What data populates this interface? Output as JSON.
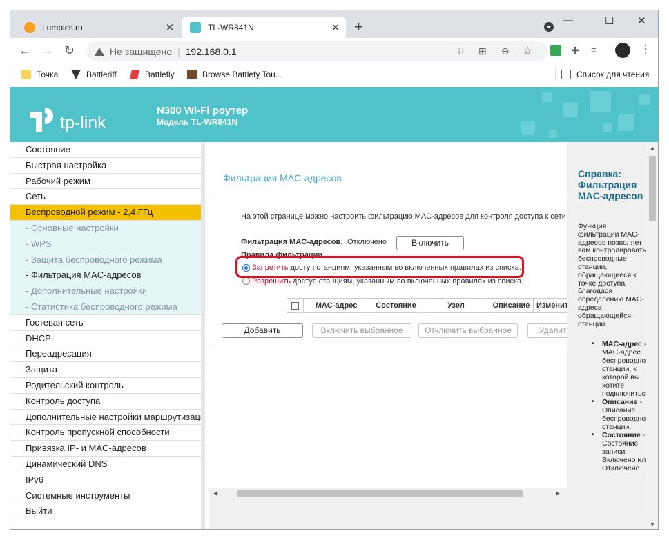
{
  "browser": {
    "tabs": [
      {
        "title": "Lumpics.ru",
        "icon": "orange-favicon",
        "close": "✕"
      },
      {
        "title": "TL-WR841N",
        "icon": "tplink-favicon",
        "close": "✕"
      }
    ],
    "new_tab": "+",
    "window_controls": {
      "minimize": "—",
      "maximize": "☐",
      "close": "✕"
    },
    "address": {
      "security_text": "Не защищено",
      "separator": "|",
      "url": "192.168.0.1"
    },
    "bookmarks": [
      {
        "label": "Точка",
        "icon": "folder-icon"
      },
      {
        "label": "Battleriff",
        "icon": "battleriff-icon"
      },
      {
        "label": "Battlefly",
        "icon": "battlefly-icon"
      },
      {
        "label": "Browse Battlefy Tou...",
        "icon": "battlefy-icon"
      }
    ],
    "reading_list": "Список для чтения",
    "accent_color": "#4fc3c9"
  },
  "router": {
    "logo_text": "tp-link",
    "model_title": "N300 Wi-Fi роутер",
    "model_subtitle": "Модель TL-WR841N"
  },
  "sidebar": {
    "items": [
      {
        "label": "Состояние",
        "kind": "main"
      },
      {
        "label": "Быстрая настройка",
        "kind": "main"
      },
      {
        "label": "Рабочий режим",
        "kind": "main"
      },
      {
        "label": "Сеть",
        "kind": "main"
      },
      {
        "label": "Беспроводной режим - 2,4 ГГц",
        "kind": "active"
      },
      {
        "label": "- Основные настройки",
        "kind": "sub"
      },
      {
        "label": "- WPS",
        "kind": "sub"
      },
      {
        "label": "- Защита беспроводного режима",
        "kind": "sub"
      },
      {
        "label": "- Фильтрация MAC-адресов",
        "kind": "sub-current"
      },
      {
        "label": "- Дополнительные настройки",
        "kind": "sub"
      },
      {
        "label": "- Статистика беспроводного режима",
        "kind": "sub-last"
      },
      {
        "label": "Гостевая сеть",
        "kind": "main"
      },
      {
        "label": "DHCP",
        "kind": "main"
      },
      {
        "label": "Переадресация",
        "kind": "main"
      },
      {
        "label": "Защита",
        "kind": "main"
      },
      {
        "label": "Родительский контроль",
        "kind": "main"
      },
      {
        "label": "Контроль доступа",
        "kind": "main"
      },
      {
        "label": "Дополнительные настройки маршрутизации",
        "kind": "main"
      },
      {
        "label": "Контроль пропускной способности",
        "kind": "main"
      },
      {
        "label": "Привязка IP- и MAC-адресов",
        "kind": "main"
      },
      {
        "label": "Динамический DNS",
        "kind": "main"
      },
      {
        "label": "IPv6",
        "kind": "main"
      },
      {
        "label": "Системные инструменты",
        "kind": "main"
      },
      {
        "label": "Выйти",
        "kind": "main"
      }
    ]
  },
  "content": {
    "title": "Фильтрация MAC-адресов",
    "description": "На этой странице можно настроить фильтрацию MAC-адресов для контроля доступа к сети г",
    "filter_label": "Фильтрация MAC-адресов:",
    "filter_status": "Отключено",
    "enable_button": "Включить",
    "rules_label": "Правила фильтрации",
    "rule_deny_word": "Запретить",
    "rule_deny_rest": " доступ станциям, указанным во включенных правилах из списка.",
    "rule_allow_word": "Разрешить",
    "rule_allow_rest": " доступ станциям, указанным во включенных правилах из списка.",
    "selected_rule": "deny",
    "table_headers": [
      "MAC-адрес",
      "Состояние",
      "Узел",
      "Описание",
      "Изменить"
    ],
    "buttons": {
      "add": "Добавить",
      "enable_selected": "Включить выбранное",
      "disable_selected": "Отключить выбранное",
      "delete": "Удалить"
    }
  },
  "help": {
    "title": "Справка: Фильтрация MAC-адресов",
    "body": "Функция фильтрации MAC-адресов позволяет вам контролировать беспроводные станции, обращающиеся к точке доступа, благодаря определению MAC-адреса обращающейся станции.",
    "items": [
      {
        "term": "MAC-адрес",
        "text": " - MAC-адрес беспроводной станции, к которой вы хотите подключиться."
      },
      {
        "term": "Описание",
        "text": " - Описание беспроводной станции."
      },
      {
        "term": "Состояние",
        "text": " - Состояние записи: Включено или Отключено."
      }
    ]
  }
}
